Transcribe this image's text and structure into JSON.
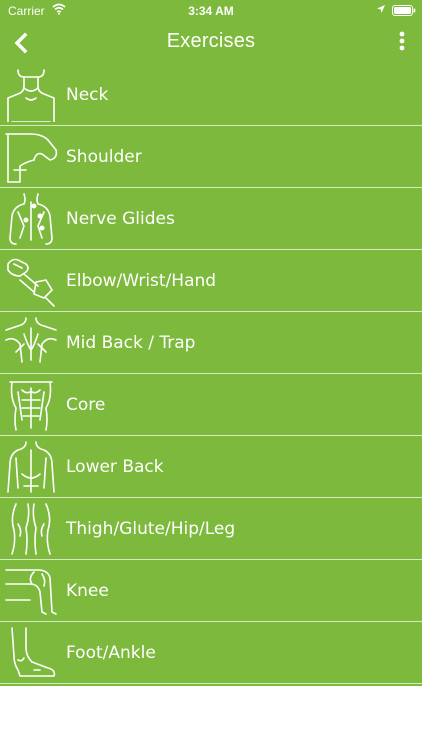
{
  "status_bar": {
    "carrier": "Carrier",
    "time": "3:34 AM"
  },
  "navbar": {
    "title": "Exercises",
    "back_icon": "chevron-left-icon",
    "menu_icon": "more-vertical-icon"
  },
  "colors": {
    "brand_green": "#7cb93c",
    "text": "#ffffff",
    "divider": "#d5e9c0"
  },
  "exercises": [
    {
      "label": "Neck",
      "icon": "neck-icon"
    },
    {
      "label": "Shoulder",
      "icon": "shoulder-icon"
    },
    {
      "label": "Nerve Glides",
      "icon": "nerve-glides-icon"
    },
    {
      "label": "Elbow/Wrist/Hand",
      "icon": "elbow-wrist-hand-icon"
    },
    {
      "label": "Mid Back / Trap",
      "icon": "mid-back-trap-icon"
    },
    {
      "label": "Core",
      "icon": "core-icon"
    },
    {
      "label": "Lower Back",
      "icon": "lower-back-icon"
    },
    {
      "label": "Thigh/Glute/Hip/Leg",
      "icon": "thigh-glute-hip-leg-icon"
    },
    {
      "label": "Knee",
      "icon": "knee-icon"
    },
    {
      "label": "Foot/Ankle",
      "icon": "foot-ankle-icon"
    }
  ]
}
